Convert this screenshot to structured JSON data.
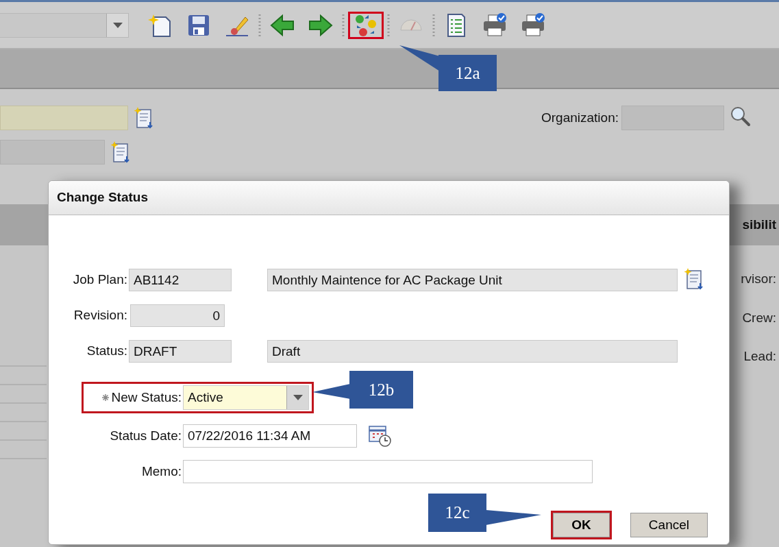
{
  "toolbar": {
    "buttons": [
      {
        "kind": "new",
        "disabled": false,
        "highlighted": false
      },
      {
        "kind": "save",
        "disabled": false,
        "highlighted": false
      },
      {
        "kind": "clear",
        "disabled": false,
        "highlighted": false
      },
      {
        "kind": "separator"
      },
      {
        "kind": "back",
        "disabled": false,
        "highlighted": false
      },
      {
        "kind": "forward",
        "disabled": false,
        "highlighted": false
      },
      {
        "kind": "separator"
      },
      {
        "kind": "status",
        "disabled": false,
        "highlighted": true
      },
      {
        "kind": "separator"
      },
      {
        "kind": "gauge",
        "disabled": true,
        "highlighted": false
      },
      {
        "kind": "separator"
      },
      {
        "kind": "report",
        "disabled": false,
        "highlighted": false
      },
      {
        "kind": "print",
        "disabled": false,
        "highlighted": false
      },
      {
        "kind": "print",
        "disabled": false,
        "highlighted": false
      }
    ]
  },
  "header": {
    "fields": [
      {
        "required": true
      },
      {
        "required": false
      }
    ],
    "organization_label": "Organization:"
  },
  "section_heading": "sibilit",
  "side_labels": [
    "rvisor:",
    "Crew:",
    "Lead:"
  ],
  "dialog": {
    "title": "Change Status",
    "rows": [
      {
        "kind": "readonly",
        "label": "Job Plan:",
        "value": "AB1142",
        "description": "Monthly Maintence for AC Package Unit",
        "required": false,
        "highlighted": false
      },
      {
        "kind": "number",
        "label": "Revision:",
        "value": "0",
        "required": false,
        "highlighted": false
      },
      {
        "kind": "readonly",
        "label": "Status:",
        "value": "DRAFT",
        "description": "Draft",
        "required": false,
        "highlighted": false
      },
      {
        "kind": "select",
        "label": "New Status:",
        "value": "Active",
        "required": true,
        "highlighted": true
      },
      {
        "kind": "datetime",
        "label": "Status Date:",
        "value": "07/22/2016 11:34 AM",
        "required": false,
        "highlighted": false
      },
      {
        "kind": "text",
        "label": "Memo:",
        "required": false,
        "highlighted": false
      }
    ],
    "buttons": [
      {
        "label": "OK",
        "highlighted": true
      },
      {
        "label": "Cancel",
        "highlighted": false
      }
    ]
  },
  "callouts": [
    {
      "label": "12a"
    },
    {
      "label": "12b"
    },
    {
      "label": "12c"
    }
  ]
}
